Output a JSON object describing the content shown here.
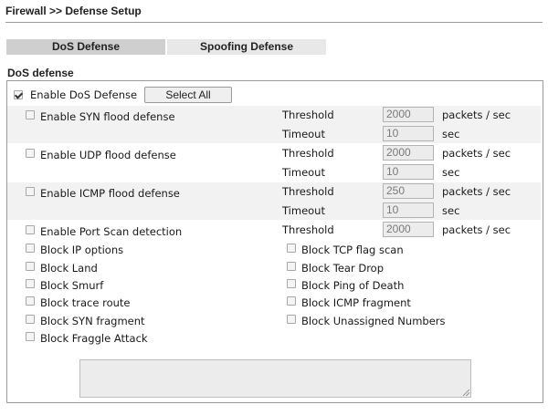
{
  "breadcrumb": "Firewall >> Defense Setup",
  "tabs": [
    {
      "label": "DoS Defense",
      "active": true
    },
    {
      "label": "Spoofing Defense",
      "active": false
    }
  ],
  "section_title": "DoS defense",
  "enable_dos": {
    "label": "Enable DoS Defense",
    "checked": true
  },
  "select_all_label": "Select All",
  "flood": [
    {
      "label": "Enable SYN flood defense",
      "checked": false,
      "threshold_label": "Threshold",
      "threshold": "2000",
      "threshold_unit": "packets / sec",
      "timeout_label": "Timeout",
      "timeout": "10",
      "timeout_unit": "sec"
    },
    {
      "label": "Enable UDP flood defense",
      "checked": false,
      "threshold_label": "Threshold",
      "threshold": "2000",
      "threshold_unit": "packets / sec",
      "timeout_label": "Timeout",
      "timeout": "10",
      "timeout_unit": "sec"
    },
    {
      "label": "Enable ICMP flood defense",
      "checked": false,
      "threshold_label": "Threshold",
      "threshold": "250",
      "threshold_unit": "packets / sec",
      "timeout_label": "Timeout",
      "timeout": "10",
      "timeout_unit": "sec"
    }
  ],
  "port_scan": {
    "label": "Enable Port Scan detection",
    "checked": false,
    "threshold_label": "Threshold",
    "threshold": "2000",
    "threshold_unit": "packets / sec"
  },
  "block_left": [
    {
      "label": "Block IP options",
      "checked": false
    },
    {
      "label": "Block Land",
      "checked": false
    },
    {
      "label": "Block Smurf",
      "checked": false
    },
    {
      "label": "Block trace route",
      "checked": false
    },
    {
      "label": "Block SYN fragment",
      "checked": false
    },
    {
      "label": "Block Fraggle Attack",
      "checked": false
    }
  ],
  "block_right": [
    {
      "label": "Block TCP flag scan",
      "checked": false
    },
    {
      "label": "Block Tear Drop",
      "checked": false
    },
    {
      "label": "Block Ping of Death",
      "checked": false
    },
    {
      "label": "Block ICMP fragment",
      "checked": false
    },
    {
      "label": "Block Unassigned Numbers",
      "checked": false
    }
  ],
  "notes_value": ""
}
